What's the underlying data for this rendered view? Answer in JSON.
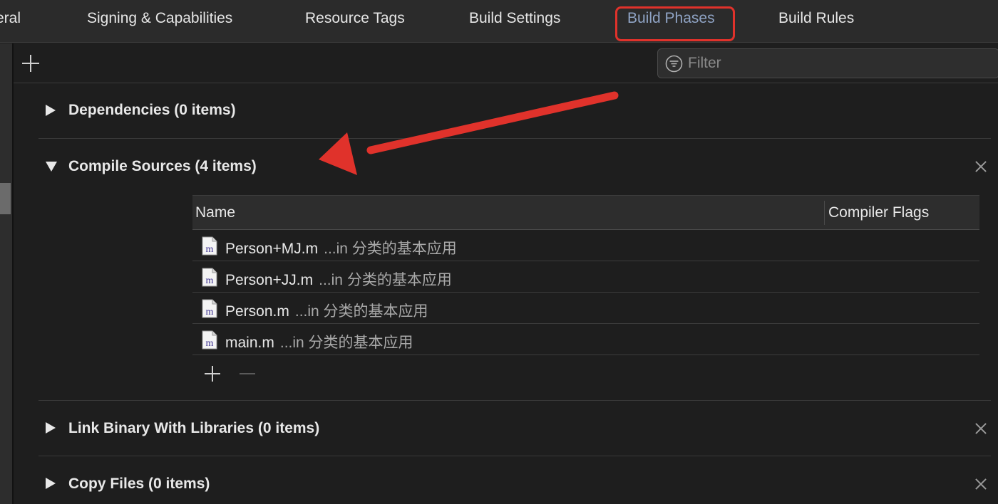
{
  "tabs": [
    {
      "label": "eral",
      "active": false
    },
    {
      "label": "Signing & Capabilities",
      "active": false
    },
    {
      "label": "Resource Tags",
      "active": false
    },
    {
      "label": "Build Settings",
      "active": false
    },
    {
      "label": "Build Phases",
      "active": true
    },
    {
      "label": "Build Rules",
      "active": false
    }
  ],
  "toolbar": {
    "add_icon": "plus-icon",
    "filter_placeholder": "Filter",
    "filter_icon": "filter-icon"
  },
  "phases": [
    {
      "title": "Dependencies (0 items)",
      "expanded": false
    },
    {
      "title": "Compile Sources (4 items)",
      "expanded": true
    },
    {
      "title": "Link Binary With Libraries (0 items)",
      "expanded": false
    },
    {
      "title": "Copy Files (0 items)",
      "expanded": false
    }
  ],
  "compile_sources": {
    "columns": [
      "Name",
      "Compiler Flags"
    ],
    "files": [
      {
        "name": "Person+MJ.m",
        "location": "...in 分类的基本应用",
        "icon_letter": "m"
      },
      {
        "name": "Person+JJ.m",
        "location": "...in 分类的基本应用",
        "icon_letter": "m"
      },
      {
        "name": "Person.m",
        "location": "...in 分类的基本应用",
        "icon_letter": "m"
      },
      {
        "name": "main.m",
        "location": "...in 分类的基本应用",
        "icon_letter": "m"
      }
    ]
  },
  "colors": {
    "background": "#1e1e1e",
    "active_tab": "#8fa3c4",
    "highlight_box": "#e0322b",
    "annotation_arrow": "#e0322b"
  }
}
